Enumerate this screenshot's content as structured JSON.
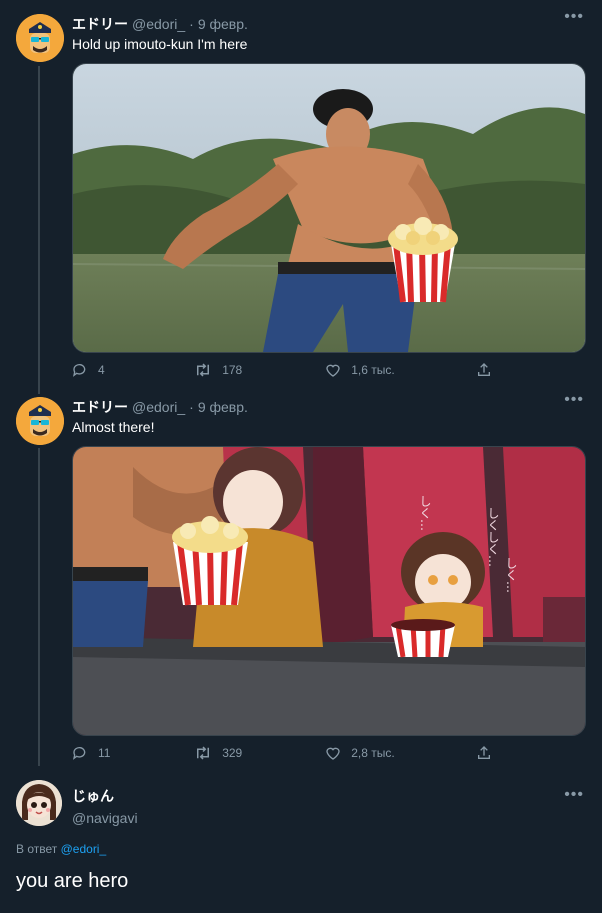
{
  "tweets": [
    {
      "name": "エドリー",
      "handle": "@edori_",
      "separator": "·",
      "time": "9 февр.",
      "text": "Hold up imouto-kun I'm here",
      "more": "•••",
      "image_desc_name": "running-man-popcorn-image",
      "replies": "4",
      "retweets": "178",
      "likes": "1,6 тыс."
    },
    {
      "name": "エドリー",
      "handle": "@edori_",
      "separator": "·",
      "time": "9 февр.",
      "text": "Almost there!",
      "more": "•••",
      "replies": "11",
      "retweets": "329",
      "likes": "2,8 тыс."
    }
  ],
  "reply": {
    "name": "じゅん",
    "handle": "@navigavi",
    "more": "•••",
    "reply_to_prefix": "В ответ",
    "reply_to_user": "@edori_",
    "text": "you are hero"
  },
  "image_text": {
    "cinema_sfx_1": "しく…",
    "cinema_sfx_2": "しくしく…",
    "cinema_sfx_3": "しく…"
  },
  "colors": {
    "background": "#15202b",
    "secondary_text": "#8899a6",
    "link": "#1da1f2",
    "divider": "#38444d"
  }
}
